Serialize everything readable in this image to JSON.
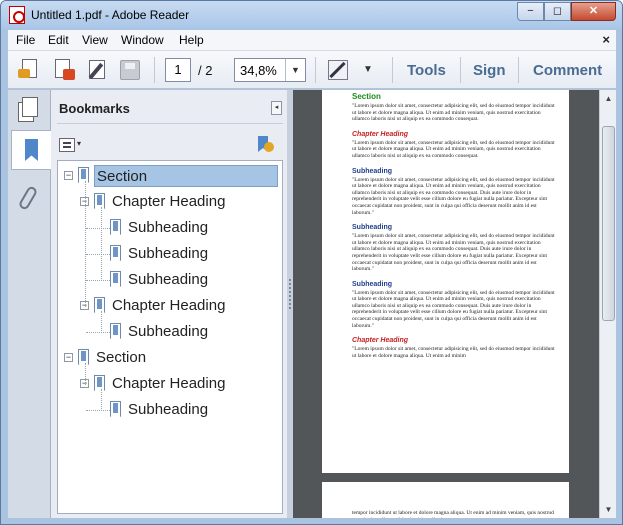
{
  "window": {
    "title": "Untitled 1.pdf - Adobe Reader",
    "minimize_glyph": "−",
    "restore_glyph": "◻",
    "close_glyph": "✕",
    "icon": "acrobat-pdf-icon"
  },
  "menubar": {
    "items": [
      "File",
      "Edit",
      "View",
      "Window",
      "Help"
    ],
    "close_glyph": "×"
  },
  "toolbar": {
    "icons": [
      "open-file-icon",
      "create-pdf-icon",
      "edit-icon",
      "save-icon",
      "fit-page-icon"
    ],
    "page_current": "1",
    "page_total": "/ 2",
    "zoom": "34,8%",
    "dropdown_glyph": "▼",
    "more_glyph": "▼",
    "tools_label": "Tools",
    "sign_label": "Sign",
    "comment_label": "Comment"
  },
  "panel": {
    "title": "Bookmarks",
    "collapse_glyph": "◂",
    "options_glyph": "▾",
    "bookmarks": [
      {
        "label": "Section",
        "level": 0,
        "toggle": "−",
        "selected": true
      },
      {
        "label": "Chapter Heading",
        "level": 1,
        "toggle": "−"
      },
      {
        "label": "Subheading",
        "level": 2,
        "toggle": ""
      },
      {
        "label": "Subheading",
        "level": 2,
        "toggle": ""
      },
      {
        "label": "Subheading",
        "level": 2,
        "toggle": ""
      },
      {
        "label": "Chapter Heading",
        "level": 1,
        "toggle": "−"
      },
      {
        "label": "Subheading",
        "level": 2,
        "toggle": ""
      },
      {
        "label": "Section",
        "level": 0,
        "toggle": "−"
      },
      {
        "label": "Chapter Heading",
        "level": 1,
        "toggle": "−"
      },
      {
        "label": "Subheading",
        "level": 2,
        "toggle": ""
      }
    ]
  },
  "document": {
    "page1": [
      {
        "kind": "section",
        "text": "Section"
      },
      {
        "kind": "body",
        "text": "\"Lorem ipsum dolor sit amet, consectetur adipisicing elit, sed do eiusmod tempor incididunt ut labore et dolore magna aliqua. Ut enim ad minim veniam, quis nostrud exercitation ullamco laboris nisi ut aliquip ex ea commodo consequat."
      },
      {
        "kind": "chapter",
        "text": "Chapter Heading"
      },
      {
        "kind": "body",
        "text": "\"Lorem ipsum dolor sit amet, consectetur adipisicing elit, sed do eiusmod tempor incididunt ut labore et dolore magna aliqua. Ut enim ad minim veniam, quis nostrud exercitation ullamco laboris nisi ut aliquip ex ea commodo consequat."
      },
      {
        "kind": "sub",
        "text": "Subheading"
      },
      {
        "kind": "body",
        "text": "\"Lorem ipsum dolor sit amet, consectetur adipisicing elit, sed do eiusmod tempor incididunt ut labore et dolore magna aliqua. Ut enim ad minim veniam, quis nostrud exercitation ullamco laboris nisi ut aliquip ex ea commodo consequat. Duis aute irure dolor in reprehenderit in voluptate velit esse cillum dolore eu fugiat nulla pariatur. Excepteur sint occaecat cupidatat non proident, sunt in culpa qui officia deserunt mollit anim id est laborum.\""
      },
      {
        "kind": "sub",
        "text": "Subheading"
      },
      {
        "kind": "body",
        "text": "\"Lorem ipsum dolor sit amet, consectetur adipisicing elit, sed do eiusmod tempor incididunt ut labore et dolore magna aliqua. Ut enim ad minim veniam, quis nostrud exercitation ullamco laboris nisi ut aliquip ex ea commodo consequat. Duis aute irure dolor in reprehenderit in voluptate velit esse cillum dolore eu fugiat nulla pariatur. Excepteur sint occaecat cupidatat non proident, sunt in culpa qui officia deserunt mollit anim id est laborum.\""
      },
      {
        "kind": "sub",
        "text": "Subheading"
      },
      {
        "kind": "body",
        "text": "\"Lorem ipsum dolor sit amet, consectetur adipisicing elit, sed do eiusmod tempor incididunt ut labore et dolore magna aliqua. Ut enim ad minim veniam, quis nostrud exercitation ullamco laboris nisi ut aliquip ex ea commodo consequat. Duis aute irure dolor in reprehenderit in voluptate velit esse cillum dolore eu fugiat nulla pariatur. Excepteur sint occaecat cupidatat non proident, sunt in culpa qui officia deserunt mollit anim id est laborum.\""
      },
      {
        "kind": "chapter",
        "text": "Chapter Heading"
      },
      {
        "kind": "body",
        "text": "\"Lorem ipsum dolor sit amet, consectetur adipisicing elit, sed do eiusmod tempor incididunt ut labore et dolore magna aliqua. Ut enim ad minim"
      }
    ],
    "page2_text": "tempor incididunt ut labore et dolore magna aliqua. Ut enim ad minim veniam, quis nostrud exercitation ullamco laboris nisi ut aliquip ex ea"
  },
  "scrollbar": {
    "up_glyph": "▲",
    "down_glyph": "▼"
  },
  "colors": {
    "section": "#1a8c1a",
    "chapter": "#c62020",
    "subheading": "#1f3f8f",
    "selection": "#a6c4e3",
    "toolbar_link": "#4a6b92"
  }
}
